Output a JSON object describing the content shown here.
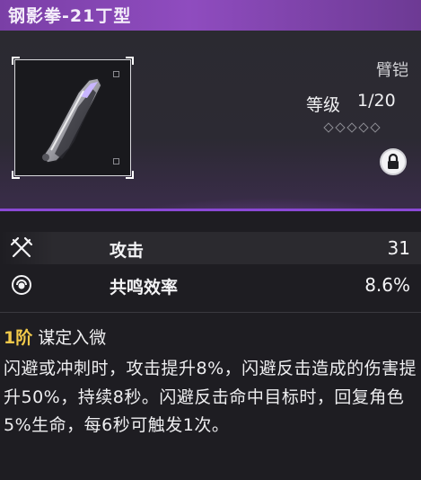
{
  "item": {
    "name": "钢影拳-21丁型",
    "type": "臂铠",
    "level_label": "等级",
    "level_value": "1/20",
    "stars_total": 5,
    "locked": true
  },
  "stats": [
    {
      "icon": "swords-icon",
      "label": "攻击",
      "value": "31"
    },
    {
      "icon": "resonance-icon",
      "label": "共鸣效率",
      "value": "8.6%"
    }
  ],
  "skill": {
    "rank": "1阶",
    "name": "谋定入微",
    "description": "闪避或冲刺时，攻击提升8%，闪避反击造成的伤害提升50%，持续8秒。闪避反击命中目标时，回复角色5%生命，每6秒可触发1次。"
  },
  "colors": {
    "title_bar": "#8f4cbf",
    "accent_purple": "#8b49d6",
    "rank_gold": "#f1c94a"
  }
}
